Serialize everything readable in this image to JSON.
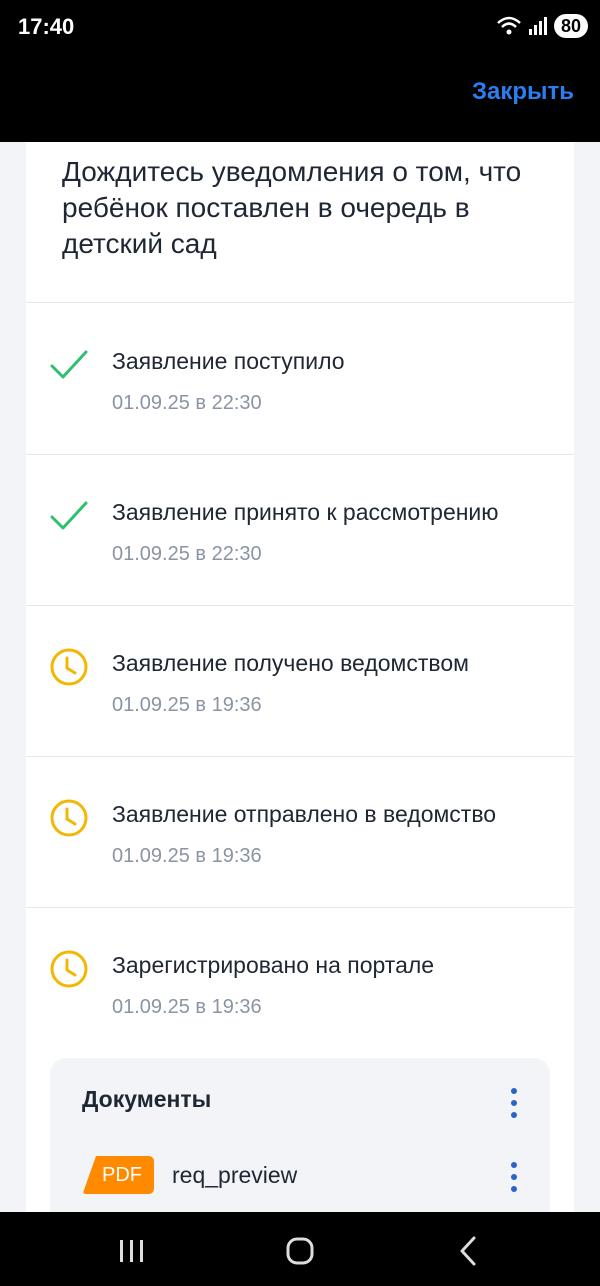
{
  "status_bar": {
    "time": "17:40",
    "battery": "80",
    "icons": [
      "wifi-icon",
      "signal-icon"
    ]
  },
  "header": {
    "close_label": "Закрыть"
  },
  "card": {
    "title": "Дождитесь уведомления о том, что ребёнок поставлен в очередь в детский сад",
    "steps": [
      {
        "title": "Заявление поступило",
        "date": "01.09.25 в 22:30",
        "status": "done",
        "icon": "check-icon"
      },
      {
        "title": "Заявление принято к рассмотрению",
        "date": "01.09.25 в 22:30",
        "status": "done",
        "icon": "check-icon"
      },
      {
        "title": "Заявление получено ведомством",
        "date": "01.09.25 в 19:36",
        "status": "pending",
        "icon": "clock-icon"
      },
      {
        "title": "Заявление отправлено в ведомство",
        "date": "01.09.25 в 19:36",
        "status": "pending",
        "icon": "clock-icon"
      },
      {
        "title": "Зарегистрировано на портале",
        "date": "01.09.25 в 19:36",
        "status": "pending",
        "icon": "clock-icon"
      }
    ]
  },
  "documents": {
    "title": "Документы",
    "items": [
      {
        "type": "PDF",
        "name": "req_preview"
      }
    ]
  },
  "colors": {
    "accent": "#2b7ef0",
    "check": "#2fbf71",
    "clock": "#f2b705",
    "pdf": "#ff8a00"
  }
}
